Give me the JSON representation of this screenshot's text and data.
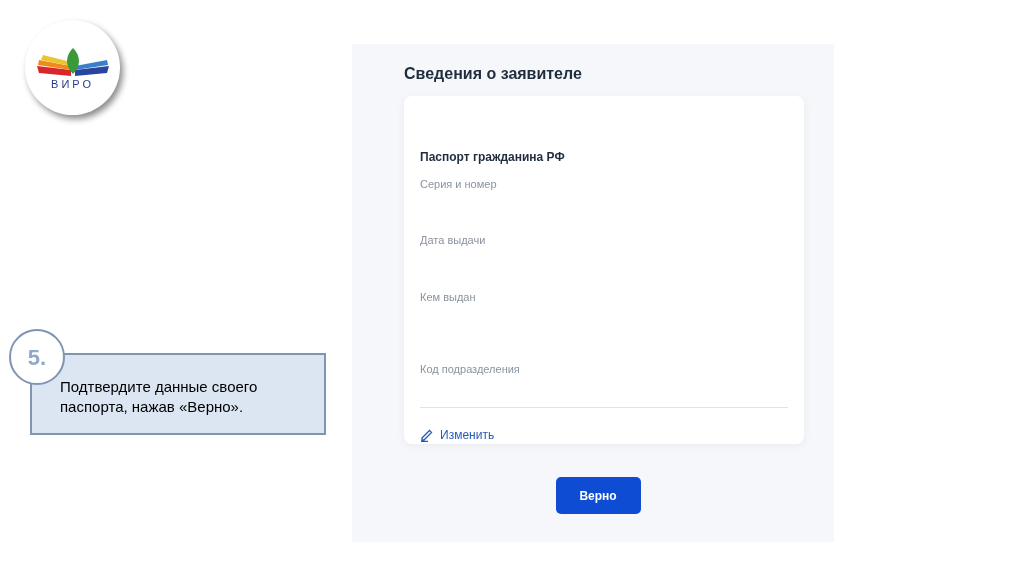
{
  "logo": {
    "text": "ВИРО"
  },
  "callout": {
    "step": "5.",
    "text": "Подтвердите данные своего паспорта, нажав «Верно»."
  },
  "form": {
    "title": "Сведения о заявителе",
    "section": "Паспорт гражданина РФ",
    "fields": [
      {
        "label": "Серия и номер"
      },
      {
        "label": "Дата выдачи"
      },
      {
        "label": "Кем выдан"
      },
      {
        "label": "Код подразделения"
      }
    ],
    "edit_link": "Изменить",
    "confirm_button": "Верно"
  }
}
